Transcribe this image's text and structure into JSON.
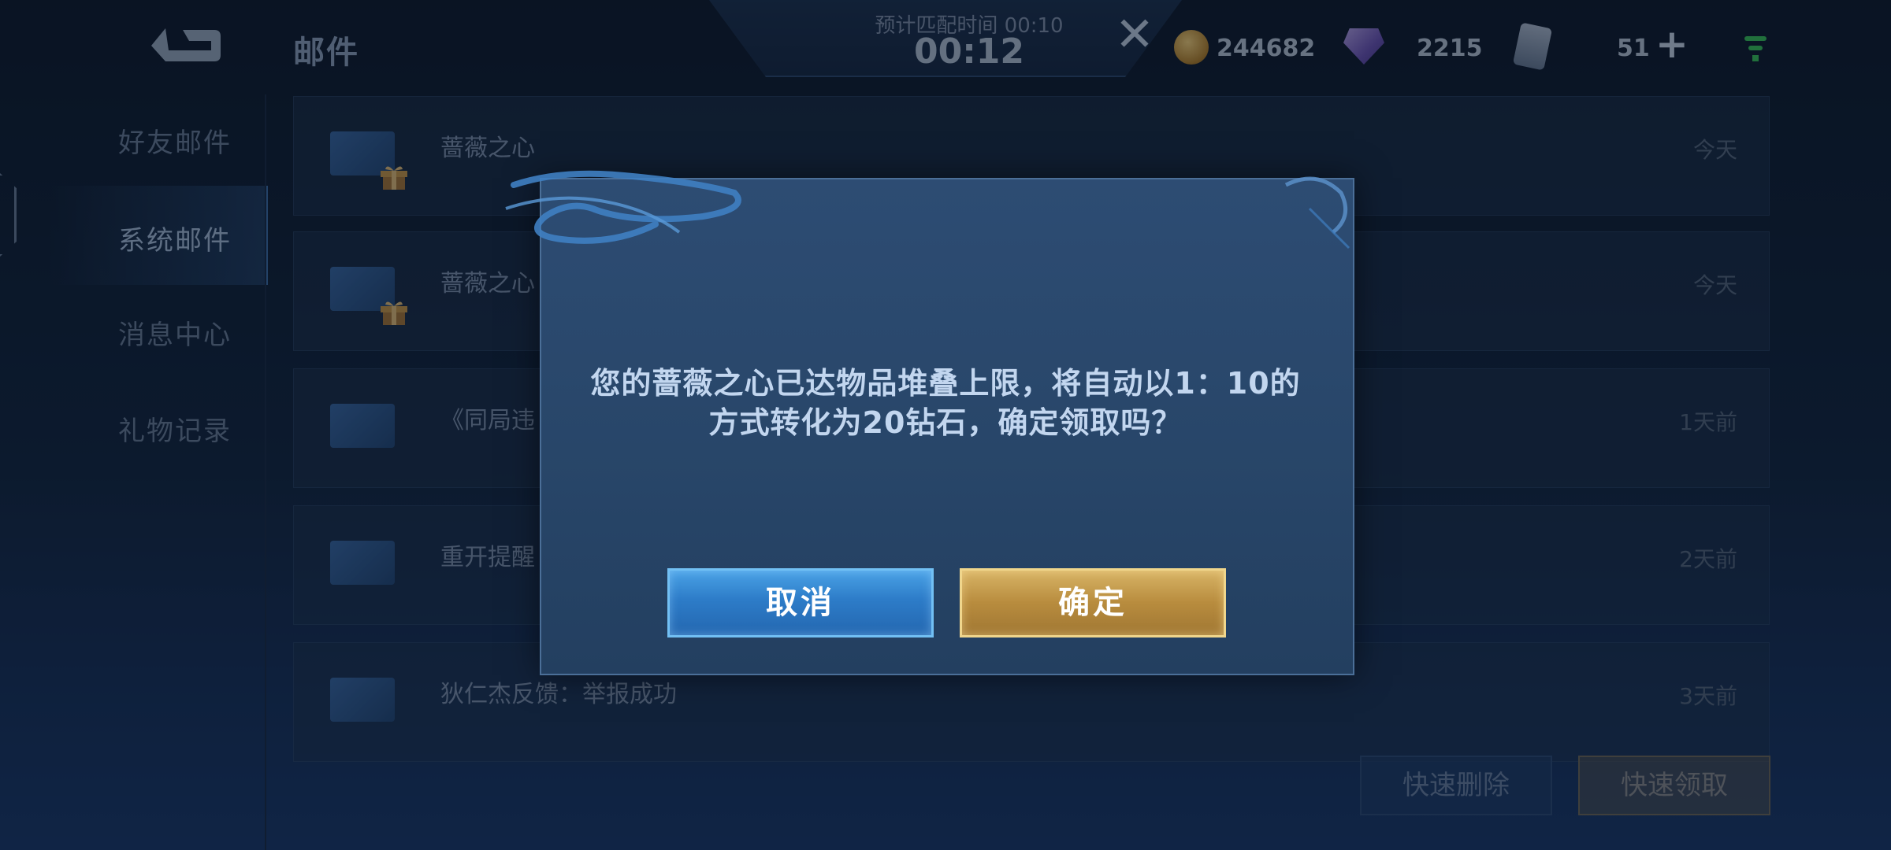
{
  "header": {
    "title": "邮件",
    "match_label": "预计匹配时间 00:10",
    "match_timer": "00:12",
    "gold": "244682",
    "gems": "2215",
    "tickets": "51"
  },
  "nav": {
    "items": [
      {
        "label": "好友邮件"
      },
      {
        "label": "系统邮件"
      },
      {
        "label": "消息中心"
      },
      {
        "label": "礼物记录"
      }
    ]
  },
  "mails": [
    {
      "title": "蔷薇之心",
      "date": "今天"
    },
    {
      "title": "蔷薇之心",
      "date": "今天"
    },
    {
      "title": "《同局违",
      "date": "1天前"
    },
    {
      "title": "重开提醒",
      "date": "2天前"
    },
    {
      "title": "狄仁杰反馈：举报成功",
      "date": "3天前"
    }
  ],
  "actions": {
    "quick_delete": "快速删除",
    "quick_claim": "快速领取"
  },
  "dialog": {
    "message_line1": "您的蔷薇之心已达物品堆叠上限，将自动以1：10的",
    "message_line2": "方式转化为20钻石，确定领取吗？",
    "cancel": "取消",
    "confirm": "确定"
  },
  "colors": {
    "cancel_button": "#2d7cc8",
    "confirm_button": "#b88c3e",
    "dialog_bg": "#2a486d"
  }
}
